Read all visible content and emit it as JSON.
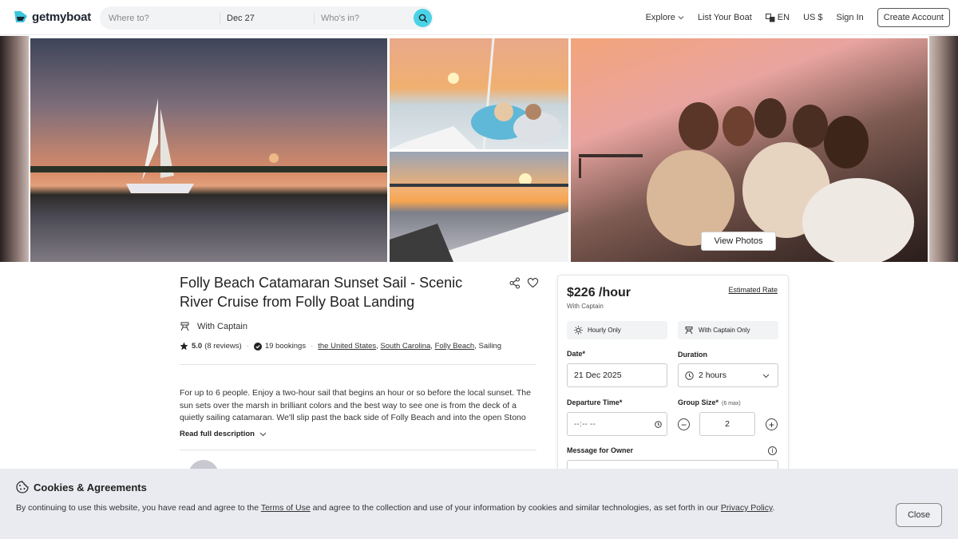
{
  "header": {
    "brand": "getmyboat",
    "search": {
      "where_placeholder": "Where to?",
      "date": "Dec 27",
      "who_placeholder": "Who's in?"
    },
    "nav": {
      "explore": "Explore",
      "list_boat": "List Your Boat",
      "language": "EN",
      "currency": "US $",
      "sign_in": "Sign In",
      "create_account": "Create Account"
    },
    "accent": "#4ad3e6"
  },
  "gallery": {
    "view_photos": "View Photos"
  },
  "listing": {
    "title": "Folly Beach Catamaran Sunset Sail - Scenic River Cruise from Folly Boat Landing",
    "captain": "With Captain",
    "rating": "5.0",
    "reviews": "(8 reviews)",
    "bookings": "19 bookings",
    "location": {
      "country": "the United States",
      "state": "South Carolina",
      "city": "Folly Beach",
      "sep1": ",",
      "sep2": ",",
      "sep3": ",",
      "category": "Sailing"
    },
    "description": "For up to 6 people. Enjoy a two-hour sail that begins an hour or so before the local sunset. The sun sets over the marsh in brilliant colors and the best way to see one is from the deck of a quietly sailing catamaran. We'll slip past the back side of Folly Beach and into the open Stono",
    "read_more": "Read full description"
  },
  "booking": {
    "price": "$226 /hour",
    "price_sub": "With Captain",
    "estimated_rate": "Estimated Rate",
    "chip_hourly": "Hourly Only",
    "chip_captain": "With Captain Only",
    "date_label": "Date*",
    "date_value": "21 Dec 2025",
    "duration_label": "Duration",
    "duration_value": "2 hours",
    "departure_label": "Departure Time*",
    "departure_placeholder": "--:-- --",
    "group_label": "Group Size*",
    "group_max": "(6 max)",
    "group_value": "2",
    "minus": "−",
    "plus": "+",
    "message_label": "Message for Owner"
  },
  "cookie": {
    "title": "Cookies & Agreements",
    "text_1": "By continuing to use this website, you have read and agree to the ",
    "terms_link": "Terms of Use",
    "text_2": " and agree to the collection and use of your information by cookies and similar technologies, as set forth in our ",
    "privacy_link": "Privacy Policy",
    "text_3": ".",
    "close": "Close"
  }
}
